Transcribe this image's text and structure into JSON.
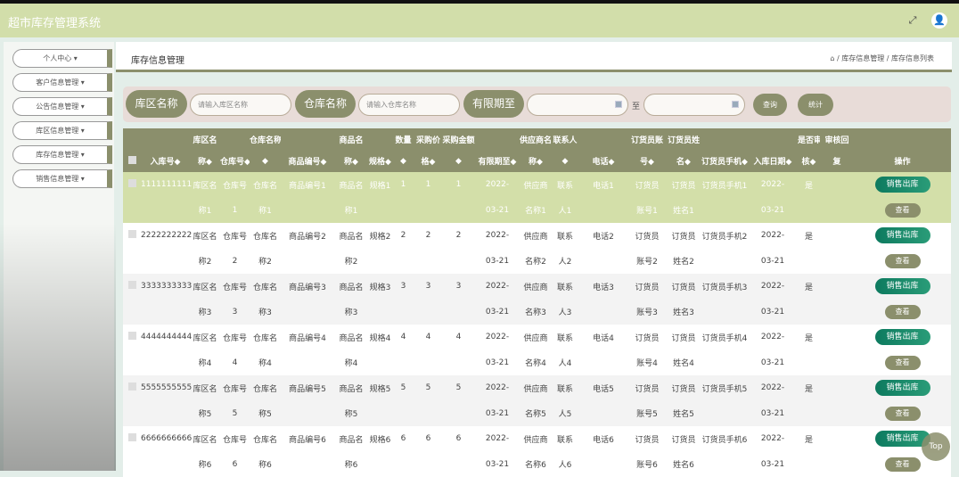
{
  "app_title": "超市库存管理系统",
  "header_icons": [
    "fullscreen-icon",
    "user-icon"
  ],
  "sidebar": {
    "items": [
      {
        "label": "个人中心"
      },
      {
        "label": "客户信息管理"
      },
      {
        "label": "公告信息管理"
      },
      {
        "label": "库区信息管理"
      },
      {
        "label": "库存信息管理"
      },
      {
        "label": "销售信息管理"
      }
    ]
  },
  "page_title": "库存信息管理",
  "breadcrumb": [
    "库存信息管理",
    "库存信息列表"
  ],
  "search": {
    "zone_label": "库区名称",
    "zone_placeholder": "请输入库区名称",
    "warehouse_label": "仓库名称",
    "warehouse_placeholder": "请输入仓库名称",
    "expiry_label": "有限期至",
    "to": "至",
    "query": "查询",
    "stats": "统计"
  },
  "columns": [
    [
      "",
      ""
    ],
    [
      "",
      "入库号◆"
    ],
    [
      "库区名",
      "称◆"
    ],
    [
      "",
      "仓库号◆"
    ],
    [
      "仓库名称",
      "◆"
    ],
    [
      "",
      "商品编号◆"
    ],
    [
      "商品名",
      "称◆"
    ],
    [
      "",
      "规格◆"
    ],
    [
      "数量",
      "◆"
    ],
    [
      "采购价",
      "格◆"
    ],
    [
      "采购金额",
      "◆"
    ],
    [
      "",
      "有限期至◆"
    ],
    [
      "供应商名",
      "称◆"
    ],
    [
      "联系人",
      "◆"
    ],
    [
      "",
      "电话◆"
    ],
    [
      "订货员账",
      "号◆"
    ],
    [
      "订货员姓",
      "名◆"
    ],
    [
      "",
      "订货员手机◆"
    ],
    [
      "",
      "入库日期◆"
    ],
    [
      "是否审",
      "核◆"
    ],
    [
      "审核回",
      "复"
    ],
    [
      "",
      "操作"
    ]
  ],
  "actions": {
    "sale": "销售出库",
    "view": "查看"
  },
  "rows": [
    {
      "id": "1111111111",
      "zone": [
        "库区名",
        "称1"
      ],
      "wno": [
        "仓库号",
        "1"
      ],
      "wname": [
        "仓库名",
        "称1"
      ],
      "code": "商品编号1",
      "pname": [
        "商品名",
        "称1"
      ],
      "spec": "规格1",
      "qty": "1",
      "price": "1",
      "amount": "1",
      "expiry": [
        "2022-",
        "03-21"
      ],
      "supplier": [
        "供应商",
        "名称1"
      ],
      "contact": [
        "联系",
        "人1"
      ],
      "phone": "电话1",
      "acct": [
        "订货员",
        "账号1"
      ],
      "oname": [
        "订货员",
        "姓名1"
      ],
      "mobile": "订货员手机1",
      "date": [
        "2022-",
        "03-21"
      ],
      "audit": "是",
      "reply": ""
    },
    {
      "id": "2222222222",
      "zone": [
        "库区名",
        "称2"
      ],
      "wno": [
        "仓库号",
        "2"
      ],
      "wname": [
        "仓库名",
        "称2"
      ],
      "code": "商品编号2",
      "pname": [
        "商品名",
        "称2"
      ],
      "spec": "规格2",
      "qty": "2",
      "price": "2",
      "amount": "2",
      "expiry": [
        "2022-",
        "03-21"
      ],
      "supplier": [
        "供应商",
        "名称2"
      ],
      "contact": [
        "联系",
        "人2"
      ],
      "phone": "电话2",
      "acct": [
        "订货员",
        "账号2"
      ],
      "oname": [
        "订货员",
        "姓名2"
      ],
      "mobile": "订货员手机2",
      "date": [
        "2022-",
        "03-21"
      ],
      "audit": "是",
      "reply": ""
    },
    {
      "id": "3333333333",
      "zone": [
        "库区名",
        "称3"
      ],
      "wno": [
        "仓库号",
        "3"
      ],
      "wname": [
        "仓库名",
        "称3"
      ],
      "code": "商品编号3",
      "pname": [
        "商品名",
        "称3"
      ],
      "spec": "规格3",
      "qty": "3",
      "price": "3",
      "amount": "3",
      "expiry": [
        "2022-",
        "03-21"
      ],
      "supplier": [
        "供应商",
        "名称3"
      ],
      "contact": [
        "联系",
        "人3"
      ],
      "phone": "电话3",
      "acct": [
        "订货员",
        "账号3"
      ],
      "oname": [
        "订货员",
        "姓名3"
      ],
      "mobile": "订货员手机3",
      "date": [
        "2022-",
        "03-21"
      ],
      "audit": "是",
      "reply": ""
    },
    {
      "id": "4444444444",
      "zone": [
        "库区名",
        "称4"
      ],
      "wno": [
        "仓库号",
        "4"
      ],
      "wname": [
        "仓库名",
        "称4"
      ],
      "code": "商品编号4",
      "pname": [
        "商品名",
        "称4"
      ],
      "spec": "规格4",
      "qty": "4",
      "price": "4",
      "amount": "4",
      "expiry": [
        "2022-",
        "03-21"
      ],
      "supplier": [
        "供应商",
        "名称4"
      ],
      "contact": [
        "联系",
        "人4"
      ],
      "phone": "电话4",
      "acct": [
        "订货员",
        "账号4"
      ],
      "oname": [
        "订货员",
        "姓名4"
      ],
      "mobile": "订货员手机4",
      "date": [
        "2022-",
        "03-21"
      ],
      "audit": "是",
      "reply": ""
    },
    {
      "id": "5555555555",
      "zone": [
        "库区名",
        "称5"
      ],
      "wno": [
        "仓库号",
        "5"
      ],
      "wname": [
        "仓库名",
        "称5"
      ],
      "code": "商品编号5",
      "pname": [
        "商品名",
        "称5"
      ],
      "spec": "规格5",
      "qty": "5",
      "price": "5",
      "amount": "5",
      "expiry": [
        "2022-",
        "03-21"
      ],
      "supplier": [
        "供应商",
        "名称5"
      ],
      "contact": [
        "联系",
        "人5"
      ],
      "phone": "电话5",
      "acct": [
        "订货员",
        "账号5"
      ],
      "oname": [
        "订货员",
        "姓名5"
      ],
      "mobile": "订货员手机5",
      "date": [
        "2022-",
        "03-21"
      ],
      "audit": "是",
      "reply": ""
    },
    {
      "id": "6666666666",
      "zone": [
        "库区名",
        "称6"
      ],
      "wno": [
        "仓库号",
        "6"
      ],
      "wname": [
        "仓库名",
        "称6"
      ],
      "code": "商品编号6",
      "pname": [
        "商品名",
        "称6"
      ],
      "spec": "规格6",
      "qty": "6",
      "price": "6",
      "amount": "6",
      "expiry": [
        "2022-",
        "03-21"
      ],
      "supplier": [
        "供应商",
        "名称6"
      ],
      "contact": [
        "联系",
        "人6"
      ],
      "phone": "电话6",
      "acct": [
        "订货员",
        "账号6"
      ],
      "oname": [
        "订货员",
        "姓名6"
      ],
      "mobile": "订货员手机6",
      "date": [
        "2022-",
        "03-21"
      ],
      "audit": "是",
      "reply": ""
    }
  ],
  "back_to_top": "Top"
}
